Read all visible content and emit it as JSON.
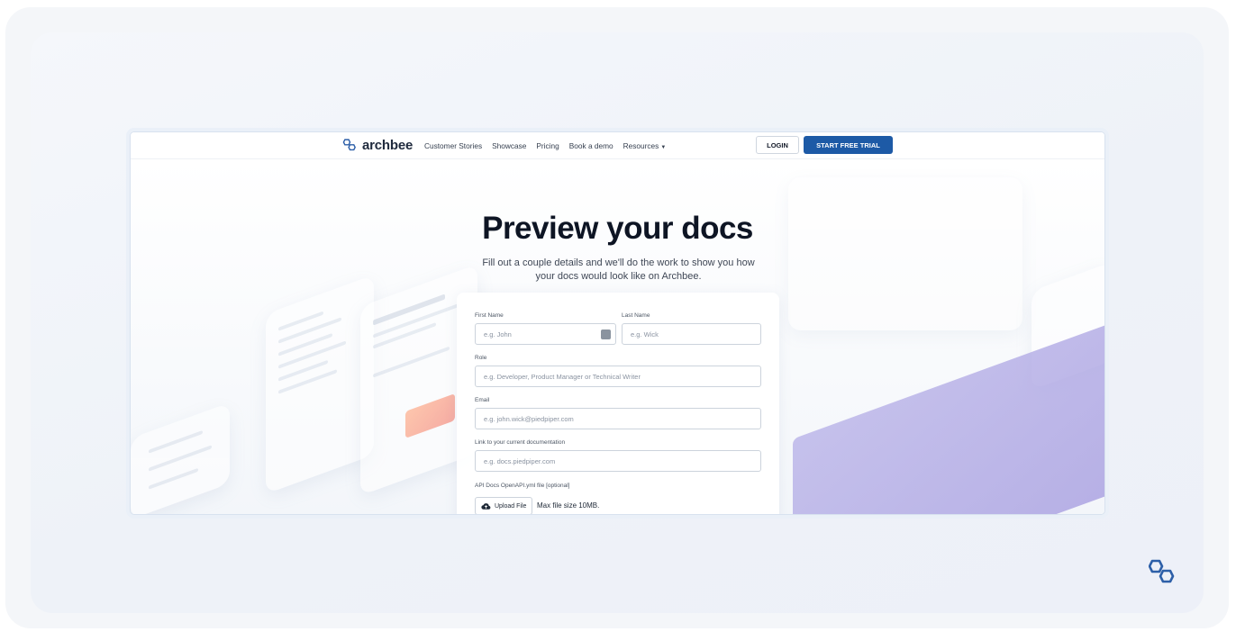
{
  "navbar": {
    "brand": "archbee",
    "links": [
      "Customer Stories",
      "Showcase",
      "Pricing",
      "Book a demo",
      "Resources"
    ],
    "login_label": "LOGIN",
    "trial_label": "START FREE TRIAL"
  },
  "hero": {
    "title": "Preview your docs",
    "subtitle": "Fill out a couple details and we'll do the work to show you how your docs would look like on Archbee."
  },
  "form": {
    "first_name": {
      "label": "First Name",
      "placeholder": "e.g. John"
    },
    "last_name": {
      "label": "Last Name",
      "placeholder": "e.g. Wick"
    },
    "role": {
      "label": "Role",
      "placeholder": "e.g. Developer, Product Manager or Technical Writer"
    },
    "email": {
      "label": "Email",
      "placeholder": "e.g. john.wick@piedpiper.com"
    },
    "docs_link": {
      "label": "Link to your current documentation",
      "placeholder": "e.g. docs.piedpiper.com"
    },
    "api_docs": {
      "label": "API Docs OpenAPI.yml file [optional]",
      "upload_label": "Upload File",
      "max_size": "Max file size 10MB."
    }
  },
  "colors": {
    "accent": "#1d5aa6",
    "title": "#0e1524",
    "logo": "#2d5fa8"
  },
  "icons": [
    "archbee-logo-icon",
    "chevron-down-icon",
    "cloud-upload-icon",
    "id-card-icon"
  ]
}
